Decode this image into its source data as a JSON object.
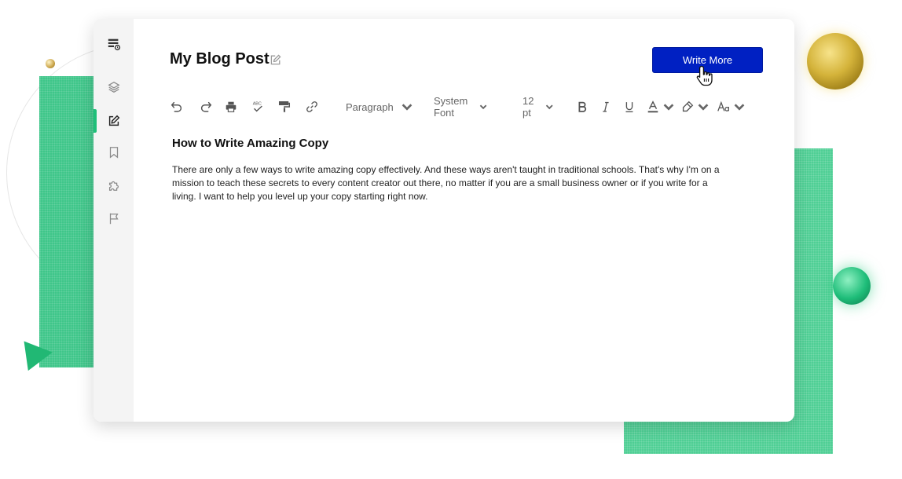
{
  "document": {
    "title": "My Blog Post",
    "heading": "How to Write Amazing Copy",
    "body": "There are only a few ways to write amazing copy effectively. And these ways aren't taught in traditional schools. That's why I'm on a mission to teach these secrets to every content creator out there, no matter if you are a small business owner or if you write for a living. I want to help you level up your copy starting right now."
  },
  "actions": {
    "write_more_label": "Write More"
  },
  "toolbar": {
    "paragraph_style": "Paragraph",
    "font_family": "System Font",
    "font_size": "12 pt",
    "spellcheck_glyph": "ABC"
  },
  "sidebar": {
    "items": [
      {
        "icon": "layers-icon"
      },
      {
        "icon": "edit-icon",
        "active": true
      },
      {
        "icon": "bookmark-icon"
      },
      {
        "icon": "puzzle-icon"
      },
      {
        "icon": "flag-icon"
      }
    ]
  },
  "colors": {
    "accent": "#1fbf79",
    "primary_button": "#0020c2",
    "decoration_green": "#3fc68a"
  }
}
